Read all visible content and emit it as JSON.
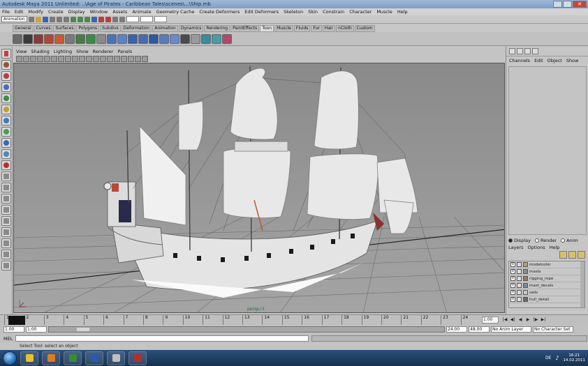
{
  "title": "Autodesk Maya 2011 Unlimited: ..\\Age of Pirates - Caribbean Tales\\scenes\\...\\Ship.mb",
  "window_controls": [
    "–",
    "□",
    "✕"
  ],
  "menubar": [
    "File",
    "Edit",
    "Modify",
    "Create",
    "Display",
    "Window",
    "Assets",
    "Animate",
    "Geometry Cache",
    "Create Deformers",
    "Edit Deformers",
    "Skeleton",
    "Skin",
    "Constrain",
    "Character",
    "Muscle",
    "Help"
  ],
  "status": {
    "menuset": "Animation"
  },
  "shelf_tabs": [
    "General",
    "Curves",
    "Surfaces",
    "Polygons",
    "Subdivs",
    "Deformation",
    "Animation",
    "Dynamics",
    "Rendering",
    "PaintEffects",
    "Toon",
    "Muscle",
    "Fluids",
    "Fur",
    "Hair",
    "nCloth",
    "Custom"
  ],
  "viewport": {
    "menu": [
      "View",
      "Shading",
      "Lighting",
      "Show",
      "Renderer",
      "Panels"
    ],
    "camera_label": "persp.r1"
  },
  "right_pane": {
    "menu": [
      "Channels",
      "Edit",
      "Object",
      "Show"
    ],
    "layer_radios": [
      "Display",
      "Render",
      "Anim"
    ],
    "layer_menu": [
      "Layers",
      "Options",
      "Help"
    ],
    "layers": [
      {
        "name": "modelcolor",
        "color": "#b0a070"
      },
      {
        "name": "masts",
        "color": "#8c8c8c"
      },
      {
        "name": "rigging_rope",
        "color": "#9a7a5a"
      },
      {
        "name": "mast_decals",
        "color": "#7a8a9a"
      },
      {
        "name": "sails",
        "color": "#c8c8c8"
      },
      {
        "name": "hull_detail",
        "color": "#6a6a6a"
      }
    ]
  },
  "timeline": {
    "ticks": [
      "1",
      "2",
      "3",
      "4",
      "5",
      "6",
      "7",
      "8",
      "9",
      "10",
      "11",
      "12",
      "13",
      "14",
      "15",
      "16",
      "17",
      "18",
      "19",
      "20",
      "21",
      "22",
      "23",
      "24"
    ],
    "current_frame": "1.00",
    "play_controls": [
      "|◀",
      "◀|",
      "◀",
      "▶",
      "|▶",
      "▶|"
    ]
  },
  "range": {
    "start": "1.00",
    "start_inner": "1.00",
    "end_inner": "24.00",
    "end": "48.00",
    "anim_layer": "No Anim Layer",
    "character": "No Character Set"
  },
  "cmdline": {
    "label": "MEL"
  },
  "helpline": "Select Tool: select an object",
  "taskbar": {
    "apps": [
      "#3a6fb0",
      "#e8c030",
      "#3a8a3a",
      "#2a5ab0",
      "#c0c0c0",
      "#b03030"
    ],
    "lang": "DE",
    "time": "16:21",
    "date": "14.02.2011"
  }
}
